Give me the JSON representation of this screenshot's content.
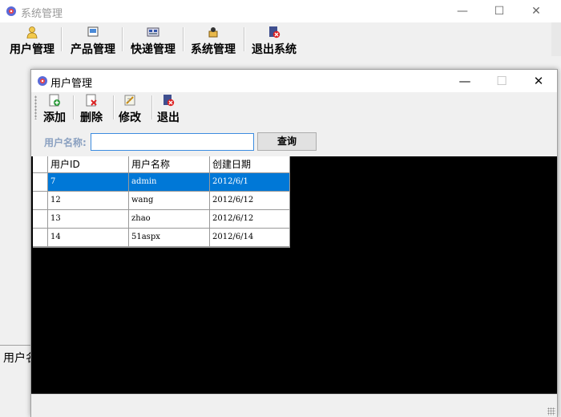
{
  "main_window": {
    "title": "系统管理",
    "controls": {
      "minimize": "—",
      "maximize": "☐",
      "close": "✕"
    },
    "toolbar": [
      {
        "label": "用户管理",
        "icon": "user-icon"
      },
      {
        "label": "产品管理",
        "icon": "product-icon"
      },
      {
        "label": "快递管理",
        "icon": "express-icon"
      },
      {
        "label": "系统管理",
        "icon": "system-icon"
      },
      {
        "label": "退出系统",
        "icon": "exit-icon"
      }
    ],
    "status_text": "用户名"
  },
  "child_window": {
    "title": "用户管理",
    "controls": {
      "minimize": "—",
      "maximize": "☐",
      "close": "✕"
    },
    "toolbar": [
      {
        "label": "添加",
        "icon": "add-icon"
      },
      {
        "label": "删除",
        "icon": "delete-icon"
      },
      {
        "label": "修改",
        "icon": "edit-icon"
      },
      {
        "label": "退出",
        "icon": "exit-icon"
      }
    ],
    "search": {
      "label": "用户名称:",
      "value": "",
      "button": "查询"
    },
    "grid": {
      "columns": [
        "用户ID",
        "用户名称",
        "创建日期"
      ],
      "rows": [
        [
          "7",
          "admin",
          "2012/6/1"
        ],
        [
          "12",
          "wang",
          "2012/6/12"
        ],
        [
          "13",
          "zhao",
          "2012/6/12"
        ],
        [
          "14",
          "51aspx",
          "2012/6/14"
        ]
      ],
      "selected_row": 0
    }
  },
  "colors": {
    "selection": "#0078d7",
    "input_border": "#3c8ce0",
    "search_label": "#8aa0c0"
  }
}
